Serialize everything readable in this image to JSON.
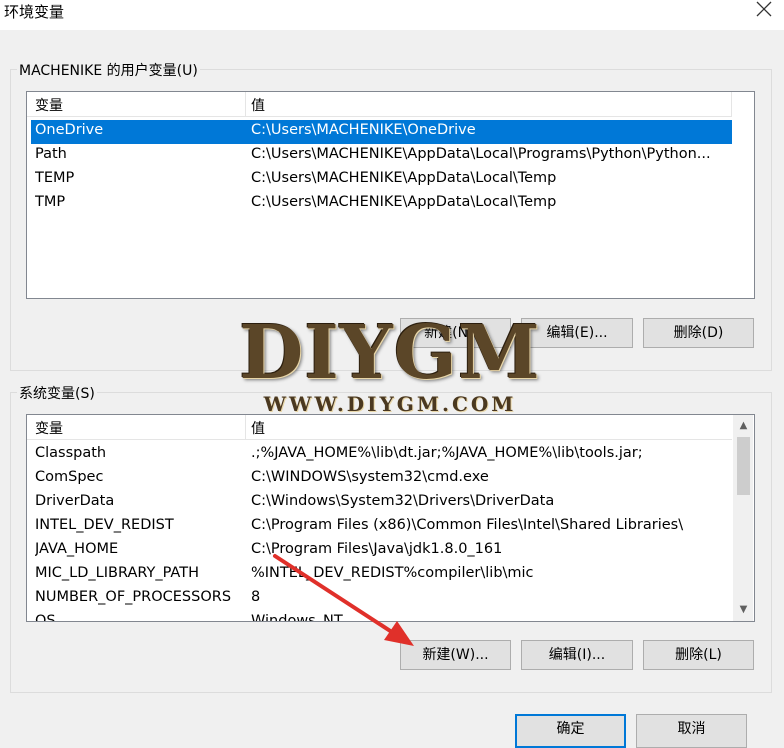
{
  "window": {
    "title": "环境变量"
  },
  "user_vars": {
    "group_label": "MACHENIKE 的用户变量(U)",
    "columns": [
      "变量",
      "值"
    ],
    "rows": [
      {
        "name": "OneDrive",
        "value": "C:\\Users\\MACHENIKE\\OneDrive",
        "selected": true
      },
      {
        "name": "Path",
        "value": "C:\\Users\\MACHENIKE\\AppData\\Local\\Programs\\Python\\Python..."
      },
      {
        "name": "TEMP",
        "value": "C:\\Users\\MACHENIKE\\AppData\\Local\\Temp"
      },
      {
        "name": "TMP",
        "value": "C:\\Users\\MACHENIKE\\AppData\\Local\\Temp"
      }
    ],
    "buttons": {
      "new": "新建(N)...",
      "edit": "编辑(E)...",
      "delete": "删除(D)"
    }
  },
  "system_vars": {
    "group_label": "系统变量(S)",
    "columns": [
      "变量",
      "值"
    ],
    "rows": [
      {
        "name": "Classpath",
        "value": ".;%JAVA_HOME%\\lib\\dt.jar;%JAVA_HOME%\\lib\\tools.jar;"
      },
      {
        "name": "ComSpec",
        "value": "C:\\WINDOWS\\system32\\cmd.exe"
      },
      {
        "name": "DriverData",
        "value": "C:\\Windows\\System32\\Drivers\\DriverData"
      },
      {
        "name": "INTEL_DEV_REDIST",
        "value": "C:\\Program Files (x86)\\Common Files\\Intel\\Shared Libraries\\"
      },
      {
        "name": "JAVA_HOME",
        "value": "C:\\Program Files\\Java\\jdk1.8.0_161"
      },
      {
        "name": "MIC_LD_LIBRARY_PATH",
        "value": "%INTEL_DEV_REDIST%compiler\\lib\\mic"
      },
      {
        "name": "NUMBER_OF_PROCESSORS",
        "value": "8"
      },
      {
        "name": "OS",
        "value": "Windows_NT"
      }
    ],
    "buttons": {
      "new": "新建(W)...",
      "edit": "编辑(I)...",
      "delete": "删除(L)"
    }
  },
  "dialog_buttons": {
    "ok": "确定",
    "cancel": "取消"
  },
  "watermark": {
    "title": "DIYGM",
    "subtitle": "WWW.DIYGM.COM"
  },
  "colors": {
    "selection": "#0078d7",
    "annotation_arrow": "#e0302a"
  }
}
